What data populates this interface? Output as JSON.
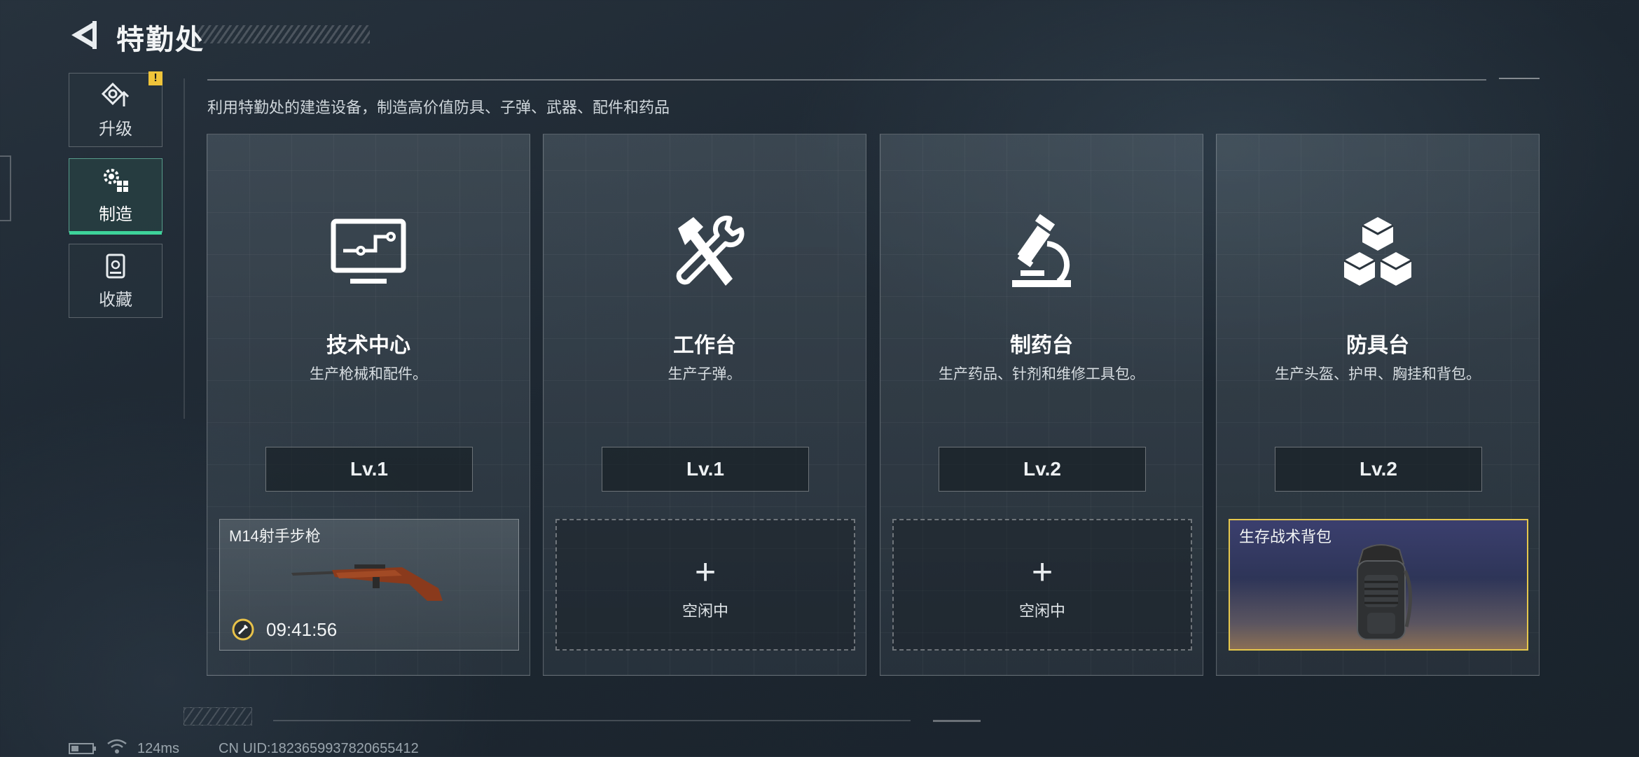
{
  "header": {
    "title": "特勤处"
  },
  "sidebar": {
    "badge": "!",
    "tabs": [
      {
        "label": "升级",
        "icon": "upgrade-icon"
      },
      {
        "label": "制造",
        "icon": "gear-craft-icon",
        "active": true
      },
      {
        "label": "收藏",
        "icon": "collection-icon"
      }
    ]
  },
  "description": "利用特勤处的建造设备，制造高价值防具、子弹、武器、配件和药品",
  "cards": [
    {
      "name": "技术中心",
      "desc": "生产枪械和配件。",
      "level": "Lv.1",
      "icon": "monitor-icon",
      "slot": {
        "state": "producing",
        "item": "M14射手步枪",
        "timer": "09:41:56"
      }
    },
    {
      "name": "工作台",
      "desc": "生产子弹。",
      "level": "Lv.1",
      "icon": "hammer-wrench-icon",
      "slot": {
        "state": "idle",
        "plus": "+",
        "status": "空闲中"
      }
    },
    {
      "name": "制药台",
      "desc": "生产药品、针剂和维修工具包。",
      "level": "Lv.2",
      "icon": "microscope-icon",
      "slot": {
        "state": "idle",
        "plus": "+",
        "status": "空闲中"
      }
    },
    {
      "name": "防具台",
      "desc": "生产头盔、护甲、胸挂和背包。",
      "level": "Lv.2",
      "icon": "cubes-icon",
      "slot": {
        "state": "completed",
        "item": "生存战术背包"
      }
    }
  ],
  "footer": {
    "ping": "124ms",
    "uid": "CN UID:1823659937820655412"
  },
  "colors": {
    "accent_green": "#3ed39a",
    "badge_yellow": "#f0c43a",
    "complete_gold": "#e6c84c"
  }
}
